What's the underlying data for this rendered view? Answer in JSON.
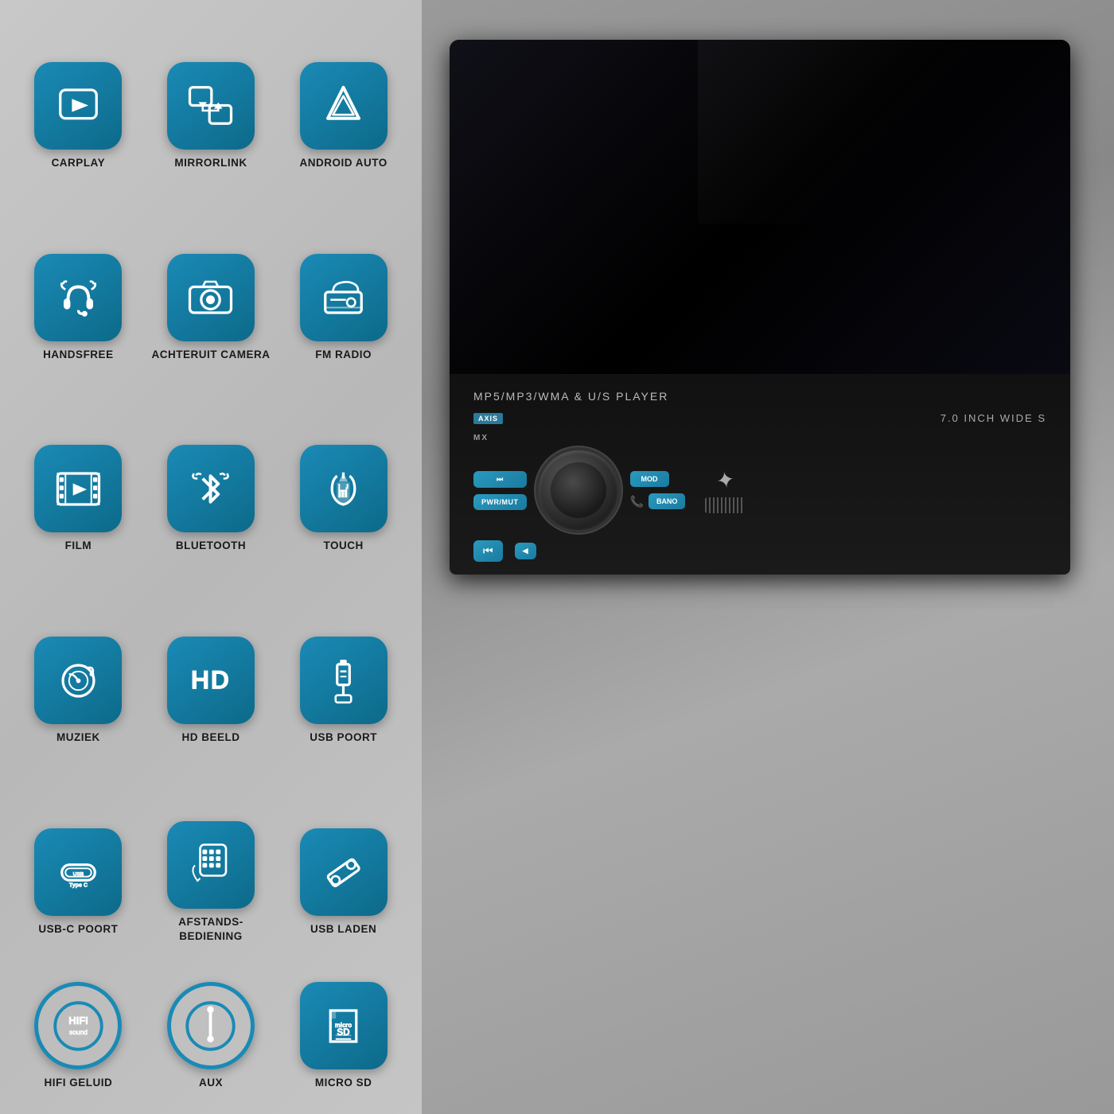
{
  "features": [
    {
      "id": "carplay",
      "label": "CARPLAY",
      "icon": "carplay"
    },
    {
      "id": "mirrorlink",
      "label": "MIRRORLINK",
      "icon": "mirrorlink"
    },
    {
      "id": "android-auto",
      "label": "ANDROID AUTO",
      "icon": "android-auto"
    },
    {
      "id": "handsfree",
      "label": "HANDSFREE",
      "icon": "handsfree"
    },
    {
      "id": "achteruit-camera",
      "label": "ACHTERUIT CAMERA",
      "icon": "camera"
    },
    {
      "id": "fm-radio",
      "label": "FM RADIO",
      "icon": "radio"
    },
    {
      "id": "film",
      "label": "FILM",
      "icon": "film"
    },
    {
      "id": "bluetooth",
      "label": "BLUETOOTH",
      "icon": "bluetooth"
    },
    {
      "id": "touch",
      "label": "TOUCH",
      "icon": "touch"
    },
    {
      "id": "muziek",
      "label": "MUZIEK",
      "icon": "music"
    },
    {
      "id": "hd-beeld",
      "label": "HD BEELD",
      "icon": "hd"
    },
    {
      "id": "usb-poort",
      "label": "USB POORT",
      "icon": "usb"
    },
    {
      "id": "usb-c-poort",
      "label": "USB-C POORT",
      "icon": "usb-c"
    },
    {
      "id": "afstands-bediening",
      "label": "AFSTANDS- BEDIENING",
      "icon": "remote"
    },
    {
      "id": "usb-laden",
      "label": "USB LADEN",
      "icon": "usb-laden"
    },
    {
      "id": "hifi-geluid",
      "label": "HIFI GELUID",
      "icon": "hifi"
    },
    {
      "id": "aux",
      "label": "AUX",
      "icon": "aux"
    },
    {
      "id": "micro-sd",
      "label": "MICRO SD",
      "icon": "sd"
    }
  ],
  "device": {
    "model_text": "MP5/MP3/WMA & U/S PLAYER",
    "brand": "AXIS",
    "size": "7.0 INCH WIDE S",
    "mx": "MX",
    "buttons": {
      "pwr_mut": "PWR/MUT",
      "mod": "MOD",
      "bano": "BANO"
    }
  },
  "usb_type_label": "USB Type"
}
